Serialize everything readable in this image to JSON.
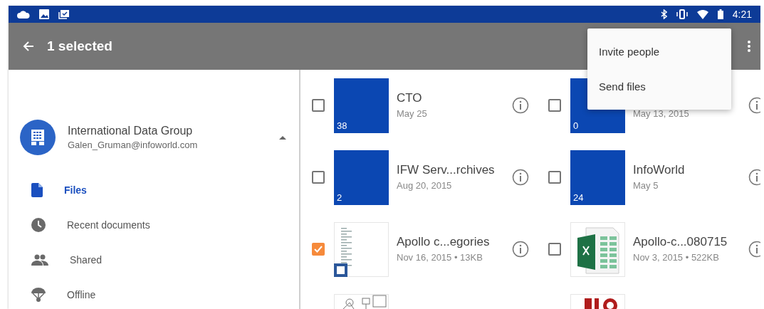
{
  "status_bar": {
    "time": "4:21"
  },
  "toolbar": {
    "title": "1 selected"
  },
  "menu": {
    "items": [
      "Invite people",
      "Send files"
    ]
  },
  "account": {
    "name": "International Data Group",
    "email": "Galen_Gruman@infoworld.com",
    "expanded": true
  },
  "nav": [
    {
      "kind": "file",
      "label": "Files",
      "selected": true
    },
    {
      "kind": "clock",
      "label": "Recent documents",
      "selected": false
    },
    {
      "kind": "people",
      "label": "Shared",
      "selected": false
    },
    {
      "kind": "offline",
      "label": "Offline",
      "selected": false
    }
  ],
  "files": [
    {
      "kind": "folder",
      "count": "38",
      "title": "CTO",
      "meta": "May 25",
      "checked": false
    },
    {
      "kind": "folder",
      "count": "0",
      "meta": "May 13, 2015",
      "checked": false
    },
    {
      "kind": "folder",
      "count": "2",
      "title": "IFW Serv...rchives",
      "meta": "Aug 20, 2015",
      "checked": false
    },
    {
      "kind": "folder",
      "count": "24",
      "title": "InfoWorld",
      "meta": "May 5",
      "checked": false
    },
    {
      "kind": "doc",
      "title": "Apollo c...egories",
      "meta": "Nov 16, 2015 • 13KB",
      "checked": true
    },
    {
      "kind": "sheet",
      "title": "Apollo-c...080715",
      "meta": "Nov 3, 2015 • 522KB",
      "checked": false
    },
    {
      "kind": "sketch"
    },
    {
      "kind": "logo"
    }
  ]
}
